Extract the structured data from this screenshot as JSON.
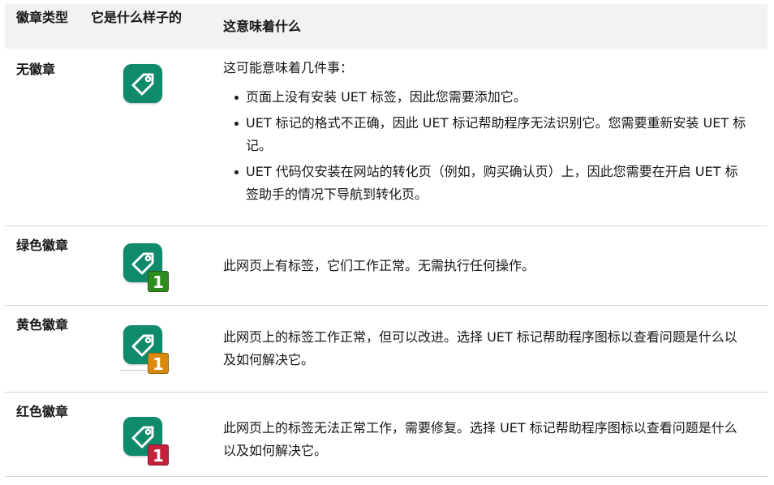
{
  "header": {
    "col_type": "徽章类型",
    "col_look": "它是什么样子的",
    "col_meaning": "这意味着什么"
  },
  "colors": {
    "tag_green": "#0f8a6b",
    "badge_green": "#2e8b1e",
    "badge_yellow": "#d98a0b",
    "badge_red": "#c4213b"
  },
  "rows": [
    {
      "type": "无徽章",
      "icon": "tag-icon",
      "badge_number": "",
      "intro": "这可能意味着几件事：",
      "bullets": [
        "页面上没有安装 UET 标签，因此您需要添加它。",
        "UET 标记的格式不正确，因此 UET 标记帮助程序无法识别它。您需要重新安装 UET 标记。",
        "UET 代码仅安装在网站的转化页（例如，购买确认页）上，因此您需要在开启 UET 标签助手的情况下导航到转化页。"
      ]
    },
    {
      "type": "绿色徽章",
      "icon": "tag-icon",
      "badge_number": "1",
      "description": "此网页上有标签，它们工作正常。无需执行任何操作。"
    },
    {
      "type": "黄色徽章",
      "icon": "tag-icon",
      "badge_number": "1",
      "description": "此网页上的标签工作正常，但可以改进。选择 UET 标记帮助程序图标以查看问题是什么以及如何解决它。"
    },
    {
      "type": "红色徽章",
      "icon": "tag-icon",
      "badge_number": "1",
      "description": "此网页上的标签无法正常工作，需要修复。选择 UET 标记帮助程序图标以查看问题是什么以及如何解决它。"
    }
  ]
}
